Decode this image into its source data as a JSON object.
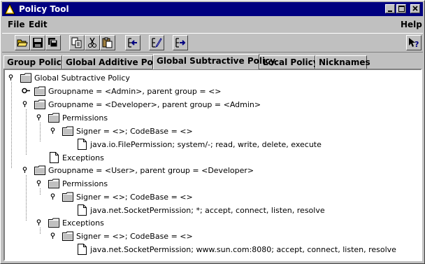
{
  "window": {
    "title": "Policy Tool"
  },
  "menubar": {
    "file": "File",
    "edit": "Edit",
    "help": "Help"
  },
  "toolbar": {
    "buttons": [
      "open-icon",
      "save-icon",
      "save-all-icon",
      "copy-icon",
      "cut-icon",
      "paste-icon",
      "add-icon",
      "edit-icon",
      "remove-icon"
    ],
    "help_button": "context-help-icon"
  },
  "tabs": [
    {
      "label": "Group Policy"
    },
    {
      "label": "Global Additive Policy"
    },
    {
      "label": "Global Subtractive Policy"
    },
    {
      "label": "Local Policy"
    },
    {
      "label": "Nicknames"
    }
  ],
  "active_tab": "Global Subtractive Policy",
  "tree": {
    "root": "Global Subtractive Policy",
    "groups": [
      {
        "label": "Groupname = <Admin>, parent group = <>"
      },
      {
        "label": "Groupname = <Developer>, parent group = <Admin>",
        "permissions": "Permissions",
        "signer": "Signer = <>; CodeBase = <>",
        "permission_entry": "java.io.FilePermission; system/-; read, write, delete, execute",
        "exceptions": "Exceptions"
      },
      {
        "label": "Groupname = <User>, parent group = <Developer>",
        "permissions": "Permissions",
        "signer": "Signer = <>; CodeBase = <>",
        "permission_entry": "java.net.SocketPermission; *; accept, connect, listen, resolve",
        "exceptions": "Exceptions",
        "exception_signer": "Signer = <>; CodeBase = <>",
        "exception_entry": "java.net.SocketPermission; www.sun.com:8080; accept, connect, listen, resolve"
      }
    ]
  }
}
